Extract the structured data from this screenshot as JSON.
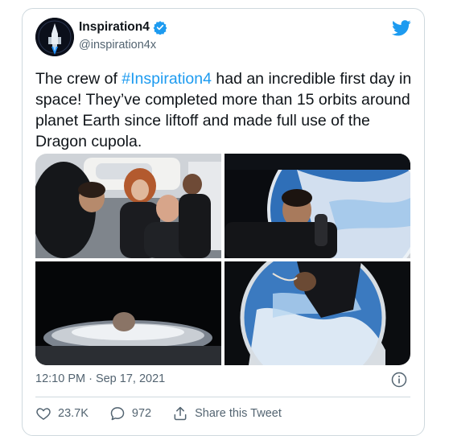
{
  "tweet": {
    "display_name": "Inspiration4",
    "handle": "@inspiration4x",
    "text_before_tag": "The crew of ",
    "hashtag": "#Inspiration4",
    "text_after_tag": " had an incredible first day in space! They’ve completed more than 15 orbits around planet Earth since liftoff and made full use of the Dragon cupola.",
    "timestamp": "12:10 PM · Sep 17, 2021",
    "likes": "23.7K",
    "replies": "972",
    "share_label": "Share this Tweet"
  },
  "colors": {
    "accent": "#1d9bf0",
    "text": "#0f1419",
    "secondary": "#536471",
    "border": "#cfd9de"
  },
  "icons": [
    "avatar-logo",
    "verified-badge-icon",
    "twitter-bird-icon",
    "info-icon",
    "heart-icon",
    "reply-icon",
    "share-icon"
  ]
}
